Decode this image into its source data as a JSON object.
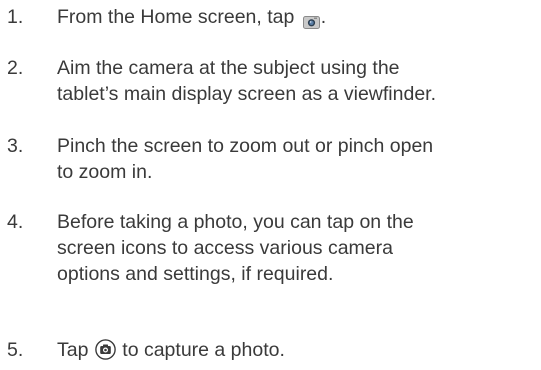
{
  "steps": [
    {
      "number": "1.",
      "text_before": "From the Home screen, tap ",
      "icon": "camera-app-icon",
      "text_after": "."
    },
    {
      "number": "2.",
      "line1": "Aim the camera at the subject using the",
      "line2": "tablet’s main display screen as a viewfinder."
    },
    {
      "number": "3.",
      "line1": "Pinch the screen to zoom out or pinch open",
      "line2": "to zoom in."
    },
    {
      "number": "4.",
      "line1": "Before taking a photo, you can tap on the",
      "line2": "screen icons to access various camera",
      "line3": "options and settings, if required."
    },
    {
      "number": "5.",
      "text_before": "Tap ",
      "icon": "shutter-button-icon",
      "text_after": " to capture a photo."
    }
  ]
}
